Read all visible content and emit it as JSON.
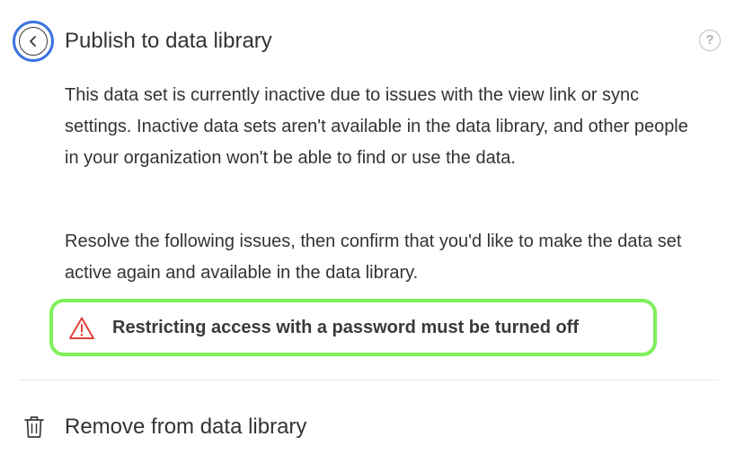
{
  "header": {
    "back_icon": "chevron-left-icon",
    "title": "Publish to data library",
    "help_icon": "question-mark-icon",
    "help_glyph": "?"
  },
  "main": {
    "paragraph_1": "This data set is currently inactive due to issues with the view link or sync settings. Inactive data sets aren't available in the data library, and other people in your organization won't be able to find or use the data.",
    "paragraph_2": "Resolve the following issues, then confirm that you'd like to make the data set active again and available in the data library.",
    "issues": [
      {
        "icon": "warning-icon",
        "text": "Restricting access with a password must be turned off"
      }
    ]
  },
  "actions": {
    "remove_icon": "trash-icon",
    "remove_label": "Remove from data library"
  },
  "colors": {
    "back_ring": "#3b73e0",
    "highlight": "#7ef05b",
    "warning": "#e0413a",
    "text": "#333333"
  }
}
